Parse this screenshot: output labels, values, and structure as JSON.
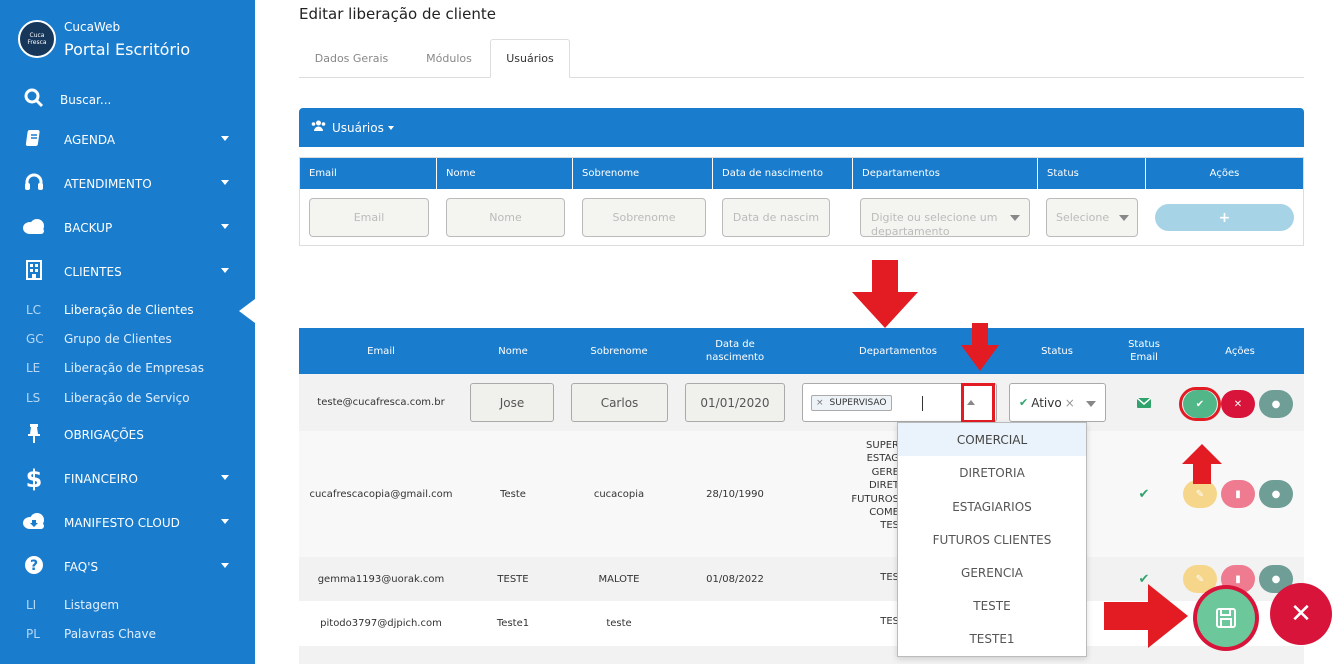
{
  "sidebar": {
    "brand_sub": "CucaWeb",
    "brand_title": "Portal Escritório",
    "logo_text": "Cuca Fresca",
    "search": "Buscar...",
    "items": [
      {
        "label": "AGENDA",
        "icon": "book-icon"
      },
      {
        "label": "ATENDIMENTO",
        "icon": "headset-icon"
      },
      {
        "label": "BACKUP",
        "icon": "cloud-icon"
      },
      {
        "label": "CLIENTES",
        "icon": "building-icon"
      },
      {
        "label": "OBRIGAÇÕES",
        "icon": "pin-icon"
      },
      {
        "label": "FINANCEIRO",
        "icon": "dollar-icon"
      },
      {
        "label": "MANIFESTO CLOUD",
        "icon": "cloud-download-icon"
      },
      {
        "label": "FAQ'S",
        "icon": "question-icon"
      }
    ],
    "clientes_sub": [
      {
        "abbr": "LC",
        "label": "Liberação de Clientes"
      },
      {
        "abbr": "GC",
        "label": "Grupo de Clientes"
      },
      {
        "abbr": "LE",
        "label": "Liberação de Empresas"
      },
      {
        "abbr": "LS",
        "label": "Liberação de Serviço"
      }
    ],
    "faq_sub": [
      {
        "abbr": "LI",
        "label": "Listagem"
      },
      {
        "abbr": "PL",
        "label": "Palavras Chave"
      }
    ]
  },
  "page": {
    "title": "Editar liberação de cliente",
    "tabs": [
      "Dados Gerais",
      "Módulos",
      "Usuários"
    ],
    "panel_title": "Usuários"
  },
  "filter": {
    "headers": [
      "Email",
      "Nome",
      "Sobrenome",
      "Data de nascimento",
      "Departamentos",
      "Status",
      "Ações"
    ],
    "placeholders": {
      "email": "Email",
      "nome": "Nome",
      "sobrenome": "Sobrenome",
      "nascimento": "Data de nascim",
      "departamentos": "Digite ou selecione um departamento",
      "status": "Selecione"
    },
    "add_label": "+"
  },
  "table": {
    "headers": [
      "Email",
      "Nome",
      "Sobrenome",
      "Data de nascimento",
      "Departamentos",
      "Status",
      "Status Email",
      "Ações"
    ],
    "edit_row": {
      "email": "teste@cucafresca.com.br",
      "nome": "Jose",
      "sobrenome": "Carlos",
      "nascimento": "01/01/2020",
      "tag": "SUPERVISAO",
      "status": "Ativo"
    },
    "rows": [
      {
        "email": "cucafrescacopia@gmail.com",
        "nome": "Teste",
        "sobrenome": "cucacopia",
        "nascimento": "28/10/1990",
        "departamentos": [
          "SUPER",
          "ESTAG",
          "GERE",
          "DIRET",
          "FUTUROS",
          "COME",
          "TES"
        ]
      },
      {
        "email": "gemma1193@uorak.com",
        "nome": "TESTE",
        "sobrenome": "MALOTE",
        "nascimento": "01/08/2022",
        "departamentos": [
          "TES"
        ]
      },
      {
        "email": "pitodo3797@djpich.com",
        "nome": "Teste1",
        "sobrenome": "teste",
        "nascimento": "",
        "departamentos": [
          "TES"
        ]
      }
    ]
  },
  "dropdown": {
    "options": [
      "COMERCIAL",
      "DIRETORIA",
      "ESTAGIARIOS",
      "FUTUROS CLIENTES",
      "GERENCIA",
      "TESTE",
      "TESTE1"
    ]
  },
  "colors": {
    "primary": "#1a7ccd",
    "annotation": "#e31b23",
    "save": "#52b788",
    "cancel": "#d8143a"
  }
}
